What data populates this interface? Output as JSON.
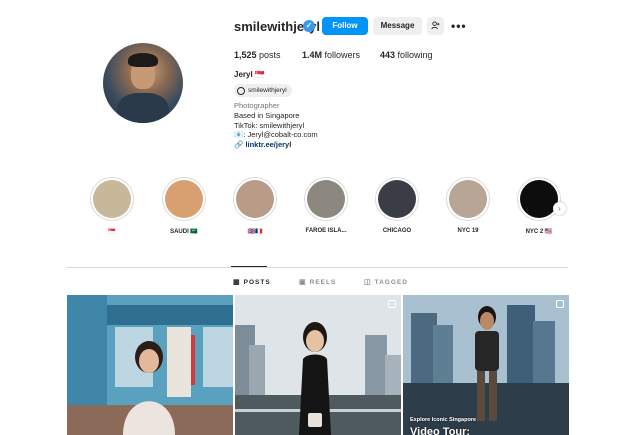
{
  "profile": {
    "username": "smilewithjeryl",
    "follow_label": "Follow",
    "message_label": "Message",
    "posts_count": "1,525",
    "posts_label": "posts",
    "followers_count": "1.4M",
    "followers_label": "followers",
    "following_count": "443",
    "following_label": "following",
    "display_name": "Jeryl 🇸🇬",
    "threads_handle": "smilewithjeryl",
    "category": "Photographer",
    "bio_lines": [
      "Based in Singapore",
      "TikTok: smilewithjeryl",
      "📧: Jeryl@cobalt-co.com"
    ],
    "link": "linktr.ee/jeryl"
  },
  "highlights": [
    {
      "label": "🇸🇬",
      "color": "#c8b89a"
    },
    {
      "label": "SAUDI 🇸🇦",
      "color": "#d8a070"
    },
    {
      "label": "🇬🇧🇫🇷",
      "color": "#b89c88"
    },
    {
      "label": "FAROE ISLA...",
      "color": "#8c8880"
    },
    {
      "label": "CHICAGO",
      "color": "#3a3d45"
    },
    {
      "label": "NYC 19",
      "color": "#b7a596"
    },
    {
      "label": "NYC 2 🇺🇸",
      "color": "#0d0d0d"
    }
  ],
  "tabs": [
    {
      "label": "POSTS",
      "icon": "grid-icon",
      "active": true
    },
    {
      "label": "REELS",
      "icon": "reels-icon",
      "active": false
    },
    {
      "label": "TAGGED",
      "icon": "tag-icon",
      "active": false
    }
  ],
  "posts": [
    {
      "caption_small": "",
      "caption_large": ""
    },
    {
      "caption_small": "",
      "caption_large": ""
    },
    {
      "caption_small": "Explore Iconic Singapore",
      "caption_large": "Video Tour:"
    }
  ],
  "colors": {
    "accent": "#0095f6",
    "verified": "#3897f0",
    "link": "#00376b"
  }
}
